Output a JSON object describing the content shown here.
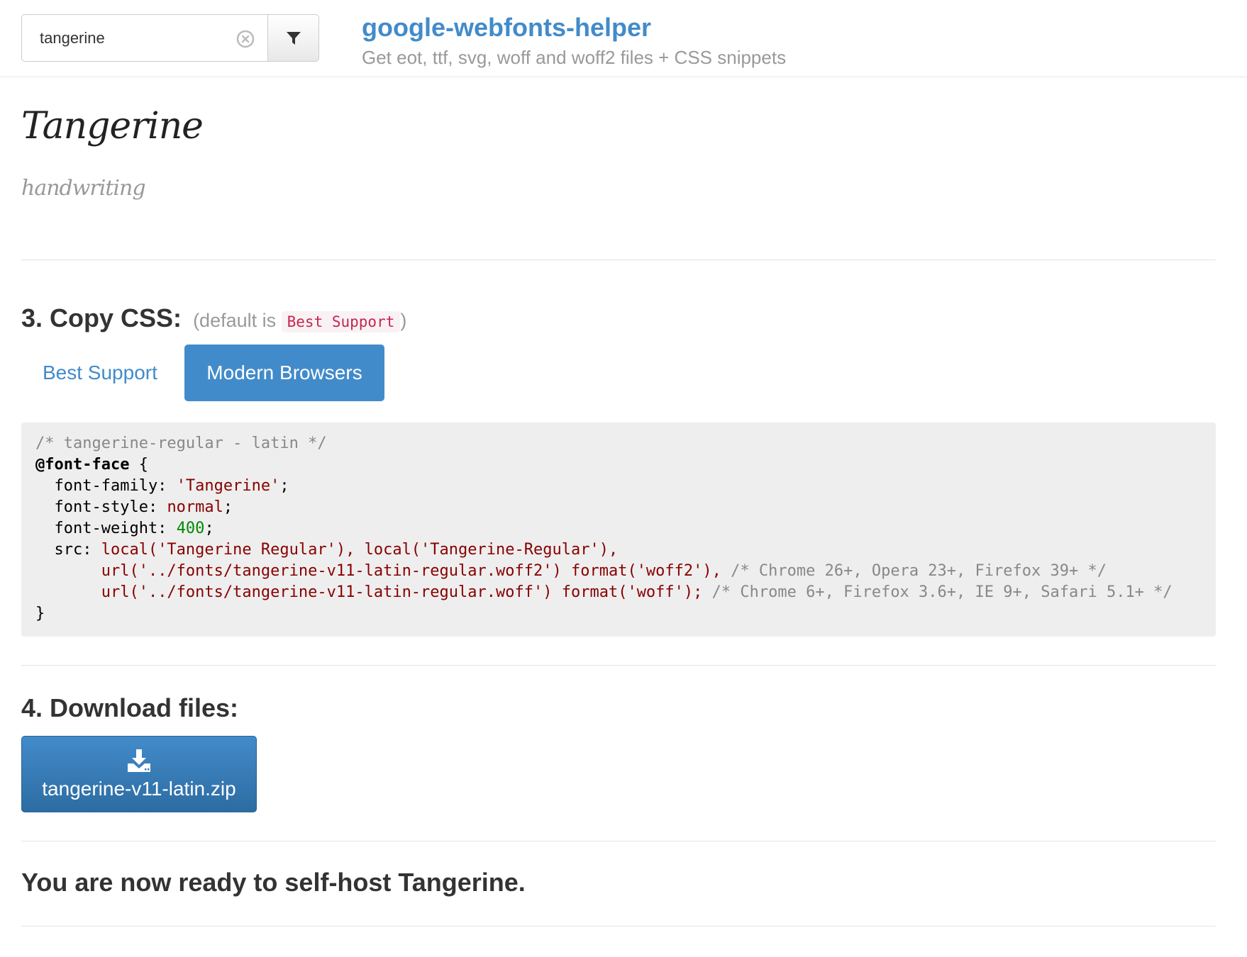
{
  "search": {
    "value": "tangerine",
    "placeholder": ""
  },
  "header": {
    "title": "google-webfonts-helper",
    "subtitle": "Get eot, ttf, svg, woff and woff2 files + CSS snippets"
  },
  "font": {
    "name": "Tangerine",
    "category": "handwriting"
  },
  "copy_css": {
    "heading": "3. Copy CSS:",
    "note_prefix": "(default is",
    "note_code": "Best Support",
    "note_suffix": ")",
    "tabs": [
      {
        "label": "Best Support",
        "active": false
      },
      {
        "label": "Modern Browsers",
        "active": true
      }
    ],
    "code": {
      "comment": "/* tangerine-regular - latin */",
      "at_rule": "@font-face",
      "open_brace": " {",
      "family_prop": "  font-family: ",
      "family_val": "'Tangerine'",
      "style_prop": "  font-style: ",
      "style_val": "normal",
      "weight_prop": "  font-weight: ",
      "weight_val": "400",
      "src_prop": "  src: ",
      "src_local": "local('Tangerine Regular'), local('Tangerine-Regular'),",
      "indent": "       ",
      "woff2_url": "url('../fonts/tangerine-v11-latin-regular.woff2') format('woff2'),",
      "woff2_comment": "/* Chrome 26+, Opera 23+, Firefox 39+ */",
      "woff_url": "url('../fonts/tangerine-v11-latin-regular.woff') format('woff');",
      "woff_comment": "/* Chrome 6+, Firefox 3.6+, IE 9+, Safari 5.1+ */",
      "close_brace": "}"
    }
  },
  "download": {
    "heading": "4. Download files:",
    "button_label": "tangerine-v11-latin.zip"
  },
  "ready": {
    "text": "You are now ready to self-host Tangerine."
  },
  "colors": {
    "accent": "#428bca",
    "code_bg": "#eeeeee",
    "string": "#880000",
    "number": "#008800",
    "comment": "#888888"
  },
  "icons": {
    "clear": "clear-circle-icon",
    "filter": "filter-funnel-icon",
    "download": "download-icon"
  }
}
